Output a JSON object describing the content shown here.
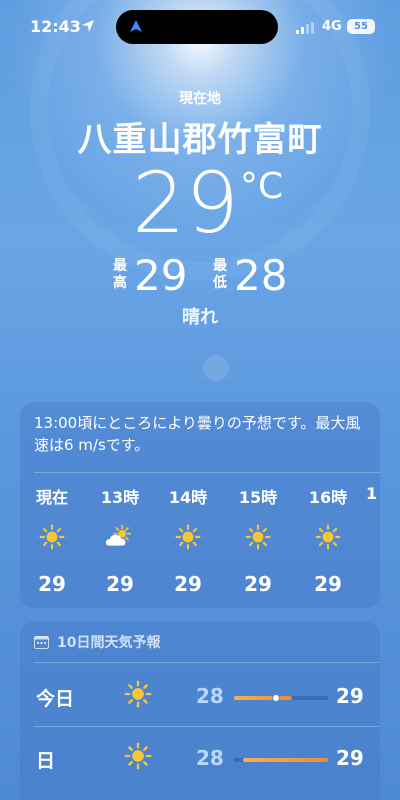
{
  "status_bar": {
    "time": "12:43",
    "network": "4G",
    "battery": "55"
  },
  "header": {
    "subtitle": "現在地",
    "location": "八重山郡竹富町",
    "temperature": "29",
    "unit": "°C",
    "high_label": "最高",
    "high": "29",
    "low_label": "最低",
    "low": "28",
    "condition": "晴れ"
  },
  "hourly": {
    "summary": "13:00頃にところにより曇りの予想です。最大風速は6 m/sです。",
    "items": [
      {
        "label": "現在",
        "icon": "sun-icon",
        "temp": "29"
      },
      {
        "label": "13時",
        "icon": "partly-cloudy-icon",
        "temp": "29"
      },
      {
        "label": "14時",
        "icon": "sun-icon",
        "temp": "29"
      },
      {
        "label": "15時",
        "icon": "sun-icon",
        "temp": "29"
      },
      {
        "label": "16時",
        "icon": "sun-icon",
        "temp": "29"
      }
    ]
  },
  "daily": {
    "title": "10日間天気予報",
    "items": [
      {
        "day": "今日",
        "icon": "sun-icon",
        "low": "28",
        "high": "29",
        "range_start": 0.0,
        "range_end": 0.62,
        "current": 0.45
      },
      {
        "day": "日",
        "icon": "sun-icon",
        "low": "28",
        "high": "29",
        "range_start": 0.1,
        "range_end": 1.0
      }
    ]
  },
  "colors": {
    "sun": "#f6c636",
    "sky": "#5f9de0",
    "range_fill": "#f08a3b"
  }
}
